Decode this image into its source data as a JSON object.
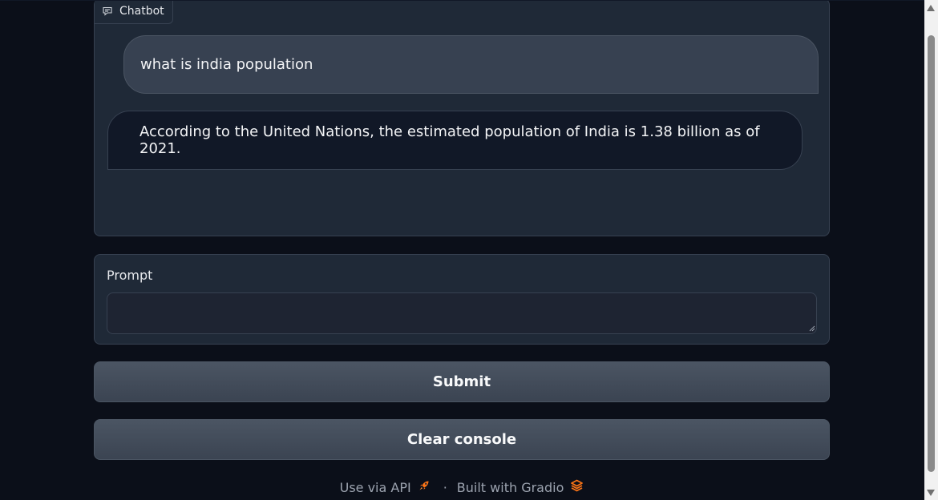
{
  "chatbot": {
    "label": "Chatbot",
    "icon": "chat-icon",
    "messages": [
      {
        "role": "user",
        "text": "what is india population"
      },
      {
        "role": "bot",
        "text": "According to the United Nations, the estimated population of India is 1.38 billion as of 2021."
      }
    ]
  },
  "prompt": {
    "label": "Prompt",
    "value": "",
    "placeholder": ""
  },
  "buttons": {
    "submit": "Submit",
    "clear": "Clear console"
  },
  "footer": {
    "api_label": "Use via API",
    "api_icon": "rocket-icon",
    "separator": "·",
    "built_label": "Built with Gradio",
    "gradio_icon": "gradio-logo-icon"
  },
  "colors": {
    "background": "#0b0f19",
    "panel": "#1f2937",
    "user_bubble": "#374151",
    "bot_bubble": "#111827",
    "accent_orange": "#f97316"
  }
}
